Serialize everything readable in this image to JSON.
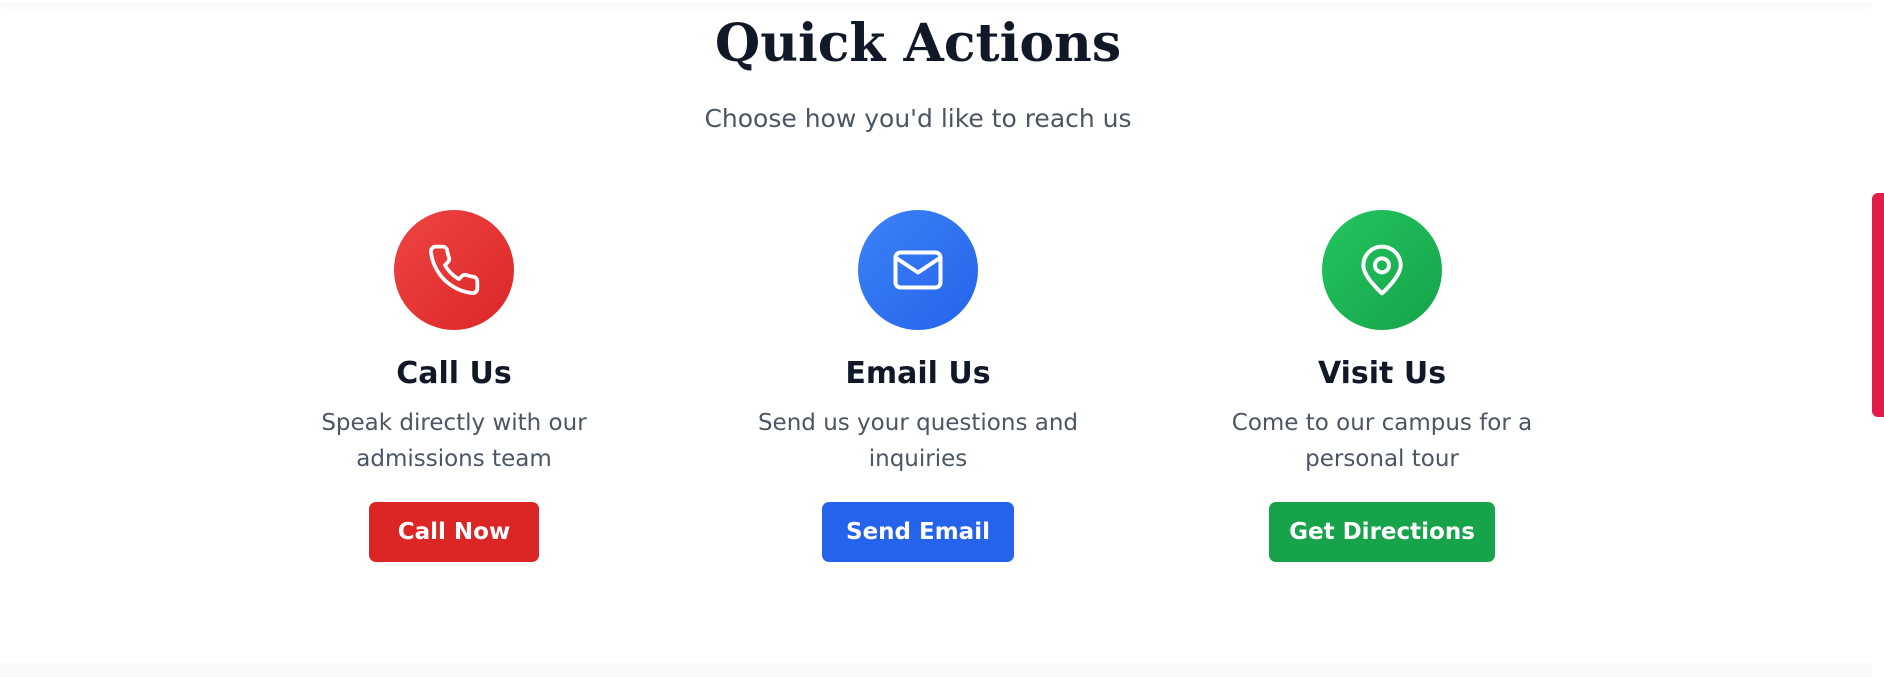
{
  "section": {
    "title": "Quick Actions",
    "subtitle": "Choose how you'd like to reach us"
  },
  "cards": [
    {
      "icon": "phone-icon",
      "color": "#dc2626",
      "title": "Call Us",
      "description": "Speak directly with our admissions team",
      "button_label": "Call Now"
    },
    {
      "icon": "mail-icon",
      "color": "#2563eb",
      "title": "Email Us",
      "description": "Send us your questions and inquiries",
      "button_label": "Send Email"
    },
    {
      "icon": "map-pin-icon",
      "color": "#16a34a",
      "title": "Visit Us",
      "description": "Come to our campus for a personal tour",
      "button_label": "Get Directions"
    }
  ],
  "colors": {
    "heading": "#111827",
    "body_text": "#4b5563",
    "scrollbar_thumb": "#e11d48"
  }
}
